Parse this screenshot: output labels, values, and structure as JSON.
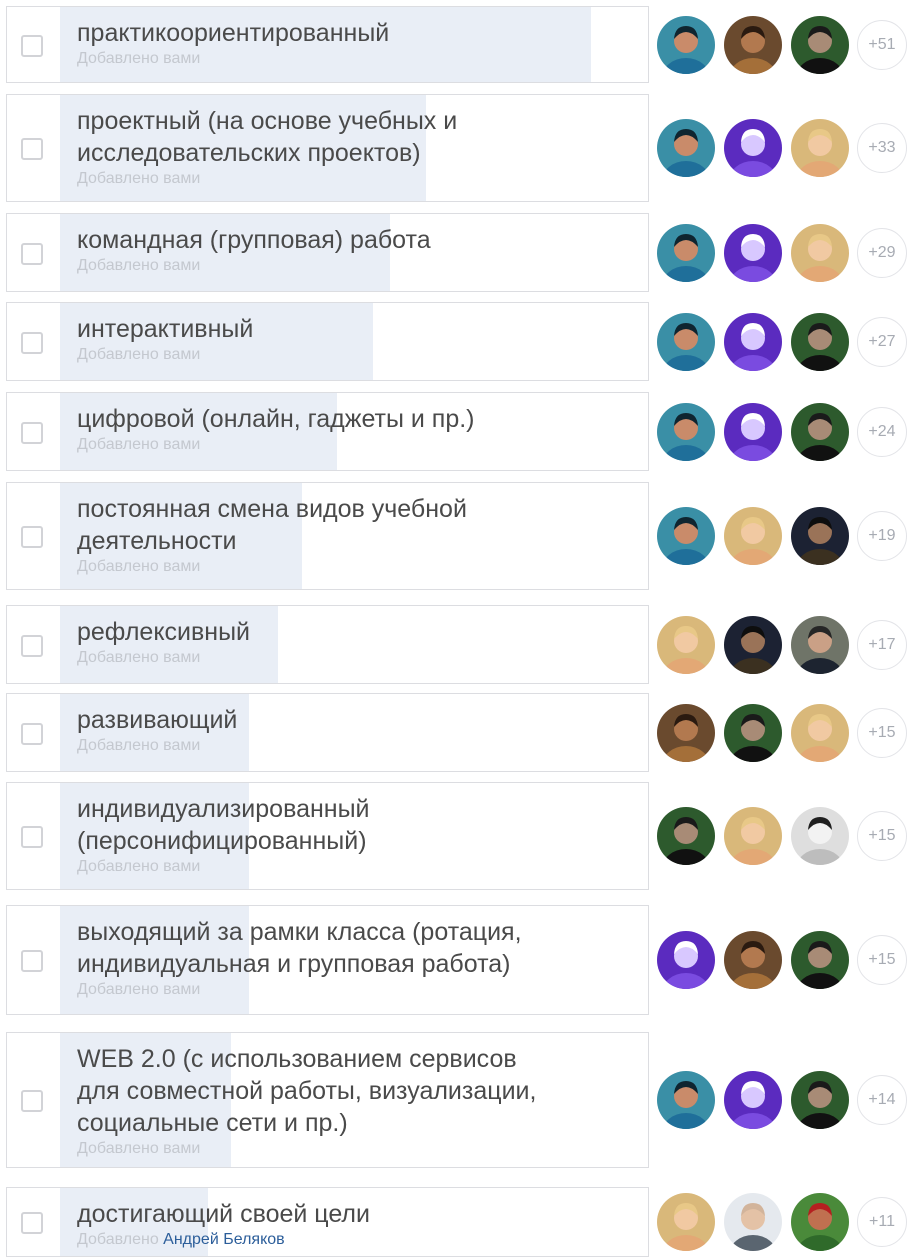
{
  "items": [
    {
      "label": "практикоориентированный",
      "added_prefix": "Добавлено",
      "added_by": "вами",
      "extra_count": "+51",
      "voters": [
        "avatar-man-blue",
        "avatar-woman-glasses",
        "avatar-man-dark"
      ],
      "vote_share": 0.9
    },
    {
      "label": "проектный (на основе учебных и\nисследовательских проектов)",
      "added_prefix": "Добавлено",
      "added_by": "вами",
      "extra_count": "+33",
      "voters": [
        "avatar-man-blue",
        "avatar-purple-light",
        "avatar-woman-blonde"
      ],
      "vote_share": 0.62
    },
    {
      "label": "командная (групповая) работа",
      "added_prefix": "Добавлено",
      "added_by": "вами",
      "extra_count": "+29",
      "voters": [
        "avatar-man-blue",
        "avatar-purple-light",
        "avatar-woman-blonde"
      ],
      "vote_share": 0.56
    },
    {
      "label": "интерактивный",
      "added_prefix": "Добавлено",
      "added_by": "вами",
      "extra_count": "+27",
      "voters": [
        "avatar-man-blue",
        "avatar-purple-light",
        "avatar-man-dark"
      ],
      "vote_share": 0.53
    },
    {
      "label": "цифровой (онлайн, гаджеты и пр.)",
      "added_prefix": "Добавлено",
      "added_by": "вами",
      "extra_count": "+24",
      "voters": [
        "avatar-man-blue",
        "avatar-purple-light",
        "avatar-man-dark"
      ],
      "vote_share": 0.47
    },
    {
      "label": "постоянная смена видов учебной\nдеятельности",
      "added_prefix": "Добавлено",
      "added_by": "вами",
      "extra_count": "+19",
      "voters": [
        "avatar-man-blue",
        "avatar-woman-blonde",
        "avatar-man-shadow"
      ],
      "vote_share": 0.41
    },
    {
      "label": "рефлексивный",
      "added_prefix": "Добавлено",
      "added_by": "вами",
      "extra_count": "+17",
      "voters": [
        "avatar-woman-blonde",
        "avatar-man-shadow",
        "avatar-man-suit"
      ],
      "vote_share": 0.37
    },
    {
      "label": "развивающий",
      "added_prefix": "Добавлено",
      "added_by": "вами",
      "extra_count": "+15",
      "voters": [
        "avatar-woman-glasses",
        "avatar-man-dark",
        "avatar-woman-blonde"
      ],
      "vote_share": 0.32
    },
    {
      "label": "индивидуализированный\n(персонифицированный)",
      "added_prefix": "Добавлено",
      "added_by": "вами",
      "extra_count": "+15",
      "voters": [
        "avatar-man-dark",
        "avatar-woman-blonde",
        "avatar-woman-bw"
      ],
      "vote_share": 0.32
    },
    {
      "label": "выходящий за рамки класса (ротация,\nиндивидуальная и групповая работа)",
      "added_prefix": "Добавлено",
      "added_by": "вами",
      "extra_count": "+15",
      "voters": [
        "avatar-purple-light",
        "avatar-woman-glasses",
        "avatar-man-dark"
      ],
      "vote_share": 0.32
    },
    {
      "label": "WEB 2.0 (с использованием сервисов\nдля совместной работы, визуализации,\nсоциальные сети и пр.)",
      "added_prefix": "Добавлено",
      "added_by": "вами",
      "extra_count": "+14",
      "voters": [
        "avatar-man-blue",
        "avatar-purple-light",
        "avatar-man-dark"
      ],
      "vote_share": 0.29
    },
    {
      "label": "достигающий своей цели",
      "added_prefix": "Добавлено",
      "added_by": "Андрей Беляков",
      "extra_count": "+11",
      "voters": [
        "avatar-woman-blonde",
        "avatar-man-bald",
        "avatar-red-flowers"
      ],
      "vote_share": 0.25
    }
  ],
  "colors": {
    "bar": "#e9eef6",
    "border": "#dcdde1",
    "label_text": "#4a4a4a",
    "muted_text": "#c4c8cf",
    "author_link": "#2c5e9a"
  }
}
